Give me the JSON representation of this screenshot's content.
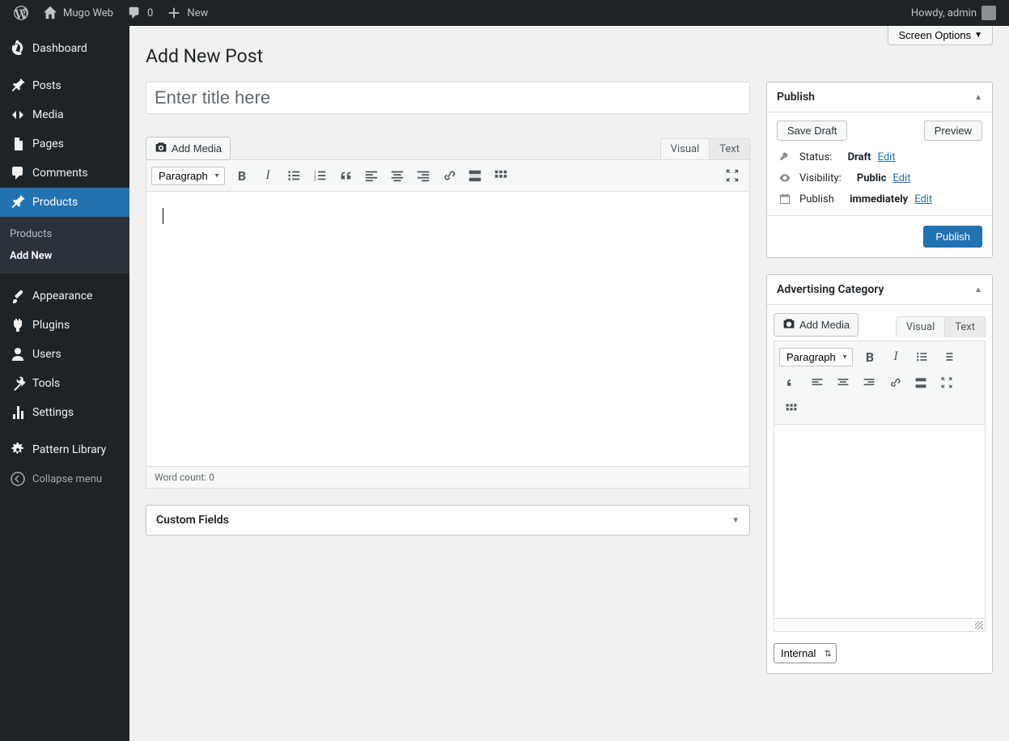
{
  "adminbar": {
    "site_name": "Mugo Web",
    "comments_count": "0",
    "new_label": "New",
    "greeting": "Howdy, admin"
  },
  "sidebar": {
    "dashboard": "Dashboard",
    "posts": "Posts",
    "media": "Media",
    "pages": "Pages",
    "comments": "Comments",
    "products": "Products",
    "appearance": "Appearance",
    "plugins": "Plugins",
    "users": "Users",
    "tools": "Tools",
    "settings": "Settings",
    "pattern_library": "Pattern Library",
    "collapse": "Collapse menu",
    "sub_products": "Products",
    "sub_addnew": "Add New"
  },
  "header": {
    "screen_options": "Screen Options",
    "page_title": "Add New Post"
  },
  "editor": {
    "title_placeholder": "Enter title here",
    "add_media": "Add Media",
    "tab_visual": "Visual",
    "tab_text": "Text",
    "format_label": "Paragraph",
    "word_count_label": "Word count: 0"
  },
  "custom_fields": {
    "heading": "Custom Fields"
  },
  "publish": {
    "heading": "Publish",
    "save_draft": "Save Draft",
    "preview": "Preview",
    "status_label": "Status:",
    "status_value": "Draft",
    "visibility_label": "Visibility:",
    "visibility_value": "Public",
    "publish_label": "Publish",
    "publish_value": "immediately",
    "edit": "Edit",
    "submit": "Publish"
  },
  "adv": {
    "heading": "Advertising Category",
    "add_media": "Add Media",
    "tab_visual": "Visual",
    "tab_text": "Text",
    "format_label": "Paragraph",
    "category_value": "Internal"
  }
}
